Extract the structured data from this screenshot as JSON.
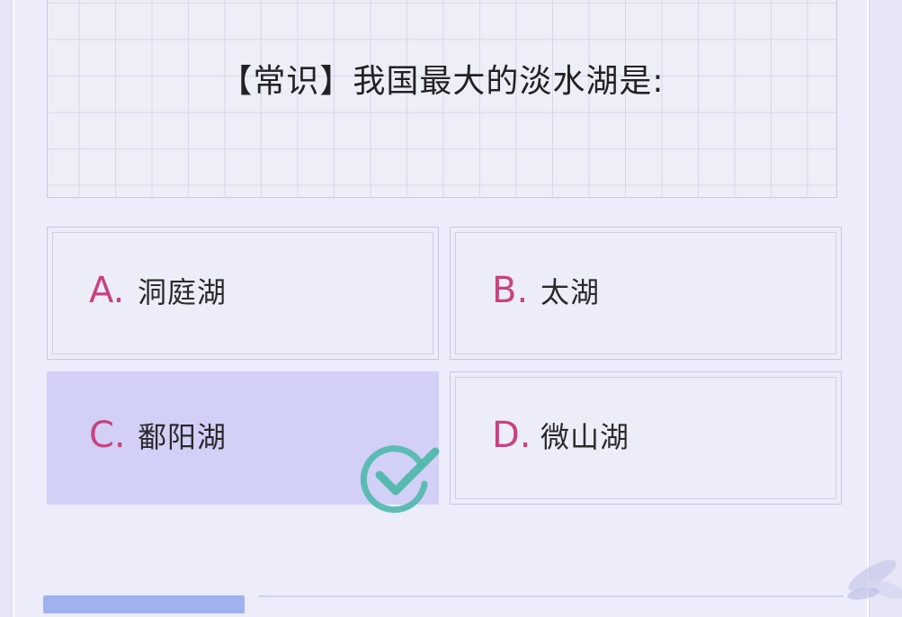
{
  "question": {
    "text": "【常识】我国最大的淡水湖是:"
  },
  "options": [
    {
      "letter": "A.",
      "text": "洞庭湖",
      "selected": false
    },
    {
      "letter": "B.",
      "text": "太湖",
      "selected": false
    },
    {
      "letter": "C.",
      "text": "鄱阳湖",
      "selected": true
    },
    {
      "letter": "D.",
      "text": "微山湖",
      "selected": false
    }
  ],
  "colors": {
    "letter": "#c8427e",
    "selected_bg": "#d2d0f7",
    "check": "#4fb8ab"
  },
  "icons": {
    "correct": "check-circle-icon",
    "decoration": "flower-decoration-icon"
  }
}
